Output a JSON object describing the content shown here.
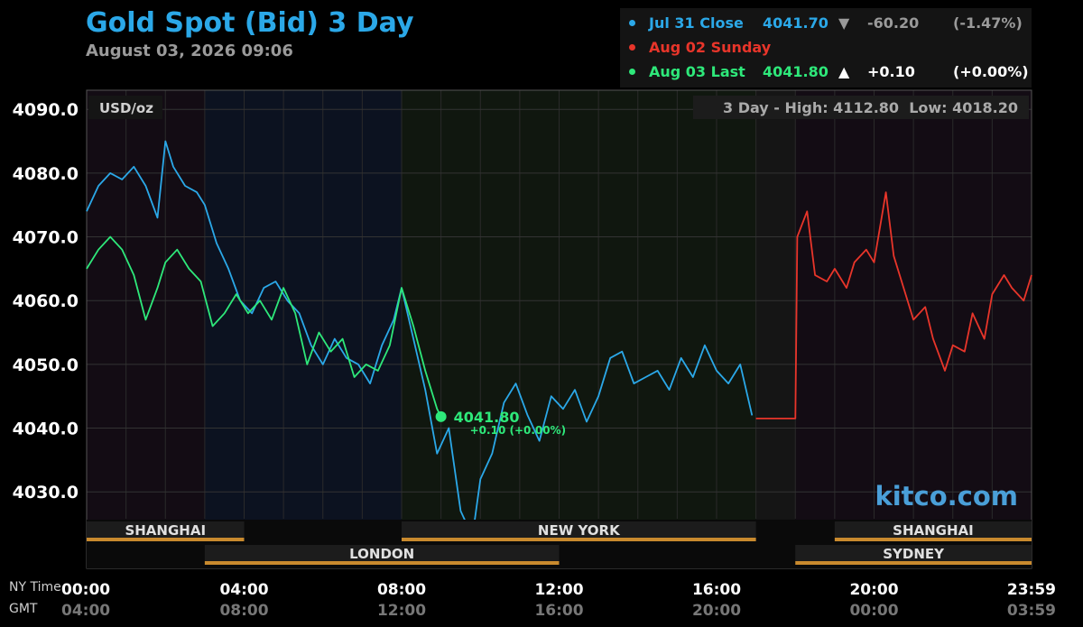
{
  "header": {
    "title": "Gold Spot (Bid) 3 Day",
    "subtitle": "August 03, 2026 09:06"
  },
  "legend": [
    {
      "label": "Jul 31 Close",
      "value": "4041.70",
      "arrow": "▼",
      "change": "-60.20",
      "pct": "(-1.47%)",
      "color": "#2ba8e8",
      "change_color": "#9a9a9a"
    },
    {
      "label": "Aug 02 Sunday",
      "value": "",
      "arrow": "",
      "change": "",
      "pct": "",
      "color": "#e8352a",
      "change_color": "#ffffff"
    },
    {
      "label": "Aug 03 Last",
      "value": "4041.80",
      "arrow": "▲",
      "change": "+0.10",
      "pct": "(+0.00%)",
      "color": "#2ee87a",
      "change_color": "#ffffff"
    }
  ],
  "colors": {
    "jul31": "#2ba8e8",
    "aug02": "#e8352a",
    "aug03": "#2ee87a",
    "session_bar": "#c98a2e",
    "watermark": "#4a9fd8"
  },
  "chart_data": {
    "type": "line",
    "unit_label": "USD/oz",
    "range_text": "3 Day - High: 4112.80  Low: 4018.20",
    "watermark": "kitco.com",
    "ylim": [
      4018,
      4093
    ],
    "y_ticks": [
      "4090.0",
      "4080.0",
      "4070.0",
      "4060.0",
      "4050.0",
      "4040.0",
      "4030.0"
    ],
    "x_ticks_ny": [
      "00:00",
      "04:00",
      "08:00",
      "12:00",
      "16:00",
      "20:00",
      "23:59"
    ],
    "x_ticks_gmt": [
      "04:00",
      "08:00",
      "12:00",
      "16:00",
      "20:00",
      "00:00",
      "03:59"
    ],
    "x_axis_titles": {
      "ny": "NY Time",
      "gmt": "GMT"
    },
    "last_annotation": {
      "value": "4041.80",
      "change": "+0.10 (+0.00%)"
    },
    "sessions": [
      {
        "name": "SHANGHAI",
        "row": 1,
        "start": 0,
        "end": 4
      },
      {
        "name": "NEW YORK",
        "row": 1,
        "start": 8,
        "end": 17
      },
      {
        "name": "SHANGHAI",
        "row": 1,
        "start": 19,
        "end": 24
      },
      {
        "name": "LONDON",
        "row": 2,
        "start": 3,
        "end": 12
      },
      {
        "name": "SYDNEY",
        "row": 2,
        "start": 18,
        "end": 24
      }
    ],
    "series": [
      {
        "name": "Jul 31 Close",
        "color": "#2ba8e8",
        "x": [
          0,
          0.3,
          0.6,
          0.9,
          1.2,
          1.5,
          1.8,
          2.0,
          2.2,
          2.5,
          2.8,
          3.0,
          3.3,
          3.6,
          3.9,
          4.2,
          4.5,
          4.8,
          5.1,
          5.4,
          5.7,
          6.0,
          6.3,
          6.6,
          6.9,
          7.2,
          7.5,
          7.8,
          8.0,
          8.3,
          8.6,
          8.9,
          9.2,
          9.5,
          9.8,
          10.0,
          10.3,
          10.6,
          10.9,
          11.2,
          11.5,
          11.8,
          12.1,
          12.4,
          12.7,
          13.0,
          13.3,
          13.6,
          13.9,
          14.2,
          14.5,
          14.8,
          15.1,
          15.4,
          15.7,
          16.0,
          16.3,
          16.6,
          16.9
        ],
        "y": [
          4074,
          4078,
          4080,
          4079,
          4081,
          4078,
          4073,
          4085,
          4081,
          4078,
          4077,
          4075,
          4069,
          4065,
          4060,
          4058,
          4062,
          4063,
          4060,
          4058,
          4053,
          4050,
          4054,
          4051,
          4050,
          4047,
          4053,
          4057,
          4062,
          4054,
          4046,
          4036,
          4040,
          4027,
          4023,
          4032,
          4036,
          4044,
          4047,
          4042,
          4038,
          4045,
          4043,
          4046,
          4041,
          4045,
          4051,
          4052,
          4047,
          4048,
          4049,
          4046,
          4051,
          4048,
          4053,
          4049,
          4047,
          4050,
          4042
        ]
      },
      {
        "name": "Aug 02 Sunday",
        "color": "#e8352a",
        "x": [
          17.0,
          17.5,
          18.0,
          18.05,
          18.3,
          18.5,
          18.8,
          19.0,
          19.3,
          19.5,
          19.8,
          20.0,
          20.3,
          20.5,
          20.8,
          21.0,
          21.3,
          21.5,
          21.8,
          22.0,
          22.3,
          22.5,
          22.8,
          23.0,
          23.3,
          23.5,
          23.8,
          24.0
        ],
        "y": [
          4041.5,
          4041.5,
          4041.5,
          4070,
          4074,
          4064,
          4063,
          4065,
          4062,
          4066,
          4068,
          4066,
          4077,
          4067,
          4061,
          4057,
          4059,
          4054,
          4049,
          4053,
          4052,
          4058,
          4054,
          4061,
          4064,
          4062,
          4060,
          4064
        ]
      },
      {
        "name": "Aug 03 Last",
        "color": "#2ee87a",
        "x": [
          0,
          0.3,
          0.6,
          0.9,
          1.2,
          1.5,
          1.8,
          2.0,
          2.3,
          2.6,
          2.9,
          3.2,
          3.5,
          3.8,
          4.1,
          4.4,
          4.7,
          5.0,
          5.3,
          5.6,
          5.9,
          6.2,
          6.5,
          6.8,
          7.1,
          7.4,
          7.7,
          8.0,
          8.3,
          8.6,
          8.9,
          9.0
        ],
        "y": [
          4065,
          4068,
          4070,
          4068,
          4064,
          4057,
          4062,
          4066,
          4068,
          4065,
          4063,
          4056,
          4058,
          4061,
          4058,
          4060,
          4057,
          4062,
          4058,
          4050,
          4055,
          4052,
          4054,
          4048,
          4050,
          4049,
          4053,
          4062,
          4056,
          4049,
          4043,
          4041.8
        ]
      }
    ]
  }
}
